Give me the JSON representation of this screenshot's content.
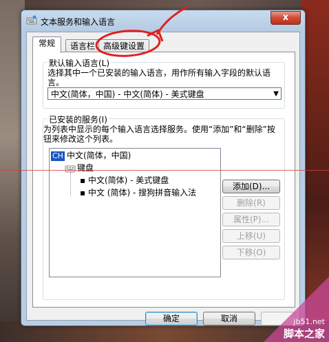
{
  "window": {
    "title": "文本服务和输入语言",
    "close_symbol": "x"
  },
  "tabs": [
    {
      "label": "常规",
      "active": true
    },
    {
      "label": "语言栏",
      "active": false
    },
    {
      "label": "高级键设置",
      "active": false
    }
  ],
  "default_language": {
    "group_title": "默认输入语言(L)",
    "description": "选择其中一个已安装的输入语言，用作所有输入字段的默认语言。",
    "selected": "中文(简体，中国) - 中文(简体) - 美式键盘"
  },
  "installed_services": {
    "group_title": "已安装的服务(I)",
    "description": "为列表中显示的每个输入语言选择服务。使用“添加”和“删除”按钮来修改这个列表。",
    "language_badge": "CH",
    "language": "中文(简体，中国)",
    "category": "键盘",
    "items": [
      "中文(简体) - 美式键盘",
      "中文 (简体) - 搜狗拼音输入法"
    ]
  },
  "side_buttons": {
    "add": "添加(D)...",
    "remove": "删除(R)",
    "properties": "属性(P)...",
    "move_up": "上移(U)",
    "move_down": "下移(O)"
  },
  "footer_buttons": {
    "ok": "确定",
    "cancel": "取消"
  },
  "watermark": {
    "site": "jb51.net",
    "name": "脚本之家"
  },
  "colors": {
    "annotation_red": "#e02020",
    "language_badge_bg": "#1a56c4"
  }
}
